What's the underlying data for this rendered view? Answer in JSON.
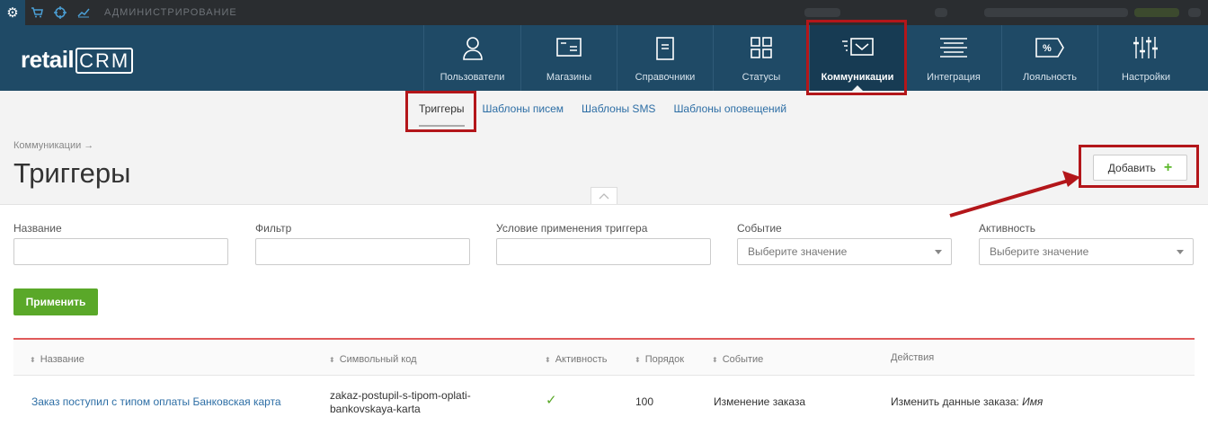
{
  "adminbar": {
    "label": "АДМИНИСТРИРОВАНИЕ",
    "icons": [
      "gear-icon",
      "cart-icon",
      "crosshair-icon",
      "chart-line-icon"
    ]
  },
  "header": {
    "logo_main": "retail",
    "logo_crm": "CRM",
    "nav": [
      {
        "label": "Пользователи",
        "icon": "user-icon"
      },
      {
        "label": "Магазины",
        "icon": "store-icon"
      },
      {
        "label": "Справочники",
        "icon": "document-icon"
      },
      {
        "label": "Статусы",
        "icon": "grid-icon"
      },
      {
        "label": "Коммуникации",
        "icon": "message-icon",
        "active": true
      },
      {
        "label": "Интеграция",
        "icon": "lines-icon"
      },
      {
        "label": "Лояльность",
        "icon": "percent-tag-icon"
      },
      {
        "label": "Настройки",
        "icon": "sliders-icon"
      }
    ]
  },
  "subnav": {
    "tabs": [
      "Триггеры",
      "Шаблоны писем",
      "Шаблоны SMS",
      "Шаблоны оповещений"
    ]
  },
  "page": {
    "breadcrumb": "Коммуникации →",
    "title": "Триггеры",
    "add_label": "Добавить",
    "add_symbol": "+"
  },
  "filters": {
    "name_label": "Название",
    "filter_label": "Фильтр",
    "condition_label": "Условие применения триггера",
    "event_label": "Событие",
    "event_placeholder": "Выберите значение",
    "activity_label": "Активность",
    "activity_placeholder": "Выберите значение",
    "apply_label": "Применить"
  },
  "table": {
    "headers": [
      "Название",
      "Символьный код",
      "Активность",
      "Порядок",
      "Событие",
      "Действия"
    ],
    "rows": [
      {
        "name": "Заказ поступил с типом оплаты Банковская карта",
        "code_line1": "zakaz-postupil-s-tipom-oplati-",
        "code_line2": "bankovskaya-karta",
        "active": "✓",
        "order": "100",
        "event": "Изменение заказа",
        "action_prefix": "Изменить данные заказа:",
        "action_field": "Имя"
      }
    ]
  },
  "colors": {
    "header_bg": "#1f4a66",
    "adminbar_bg": "#2a2d30",
    "link": "#2d6ea5",
    "apply_green": "#5aa829",
    "annotation_red": "#b3161a"
  }
}
